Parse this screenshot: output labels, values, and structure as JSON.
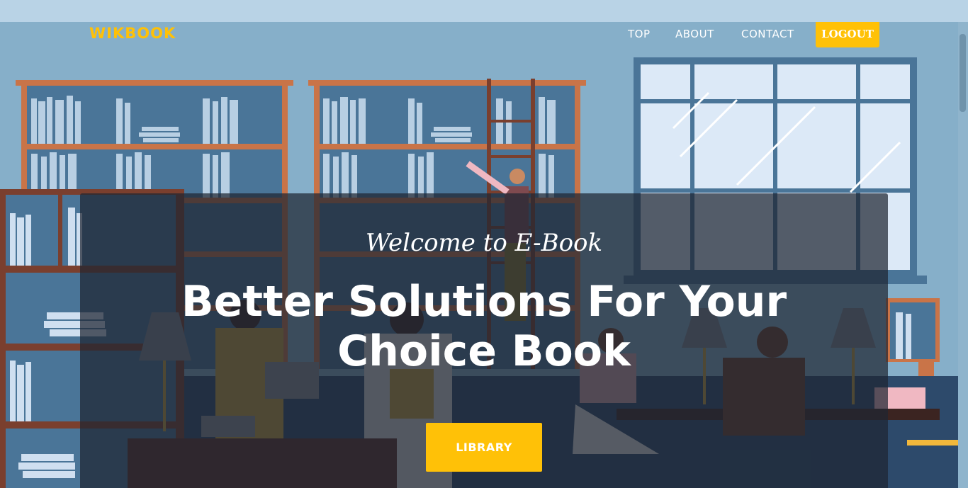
{
  "nav": {
    "brand": "WIKBOOK",
    "items": [
      {
        "label": "TOP"
      },
      {
        "label": "ABOUT"
      },
      {
        "label": "CONTACT"
      }
    ],
    "logout_label": "LOGOUT"
  },
  "hero": {
    "welcome": "Welcome to E-Book",
    "headline_line1": "Better Solutions For Your",
    "headline_line2": "Choice Book",
    "library_label": "LIBRARY"
  },
  "colors": {
    "accent": "#ffc107",
    "background": "#86afc9",
    "shelf_wood": "#c97448",
    "overlay": "#1e2632"
  },
  "icons": [
    "library-illustration"
  ]
}
